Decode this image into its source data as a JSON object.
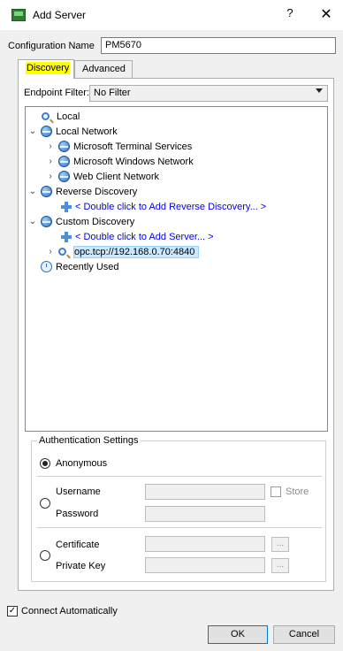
{
  "window": {
    "title": "Add Server",
    "help_label": "?",
    "close_label": "✕"
  },
  "config": {
    "label": "Configuration Name",
    "value": "PM5670"
  },
  "tabs": [
    {
      "label": "Discovery"
    },
    {
      "label": "Advanced"
    }
  ],
  "filter": {
    "label": "Endpoint Filter:",
    "value": "No Filter"
  },
  "tree": {
    "local": "Local",
    "local_network": "Local Network",
    "ms_terminal": "Microsoft Terminal Services",
    "ms_windows": "Microsoft Windows Network",
    "web_client": "Web Client Network",
    "reverse_discovery": "Reverse Discovery",
    "add_reverse": "< Double click to Add Reverse Discovery... >",
    "custom_discovery": "Custom Discovery",
    "add_server": "< Double click to Add Server... >",
    "opc_url": "opc.tcp://192.168.0.70:4840",
    "recently_used": "Recently Used"
  },
  "auth": {
    "legend": "Authentication Settings",
    "anonymous": "Anonymous",
    "username": "Username",
    "password": "Password",
    "store": "Store",
    "certificate": "Certificate",
    "private_key": "Private Key",
    "browse": "..."
  },
  "footer": {
    "connect_auto": "Connect Automatically",
    "checkmark": "✓",
    "ok": "OK",
    "cancel": "Cancel"
  },
  "icons": {
    "expanded": "⌄",
    "collapsed": "›"
  },
  "colors": {
    "highlight": "#ffff00",
    "link": "#0000ee",
    "selection": "#cce8ff"
  }
}
